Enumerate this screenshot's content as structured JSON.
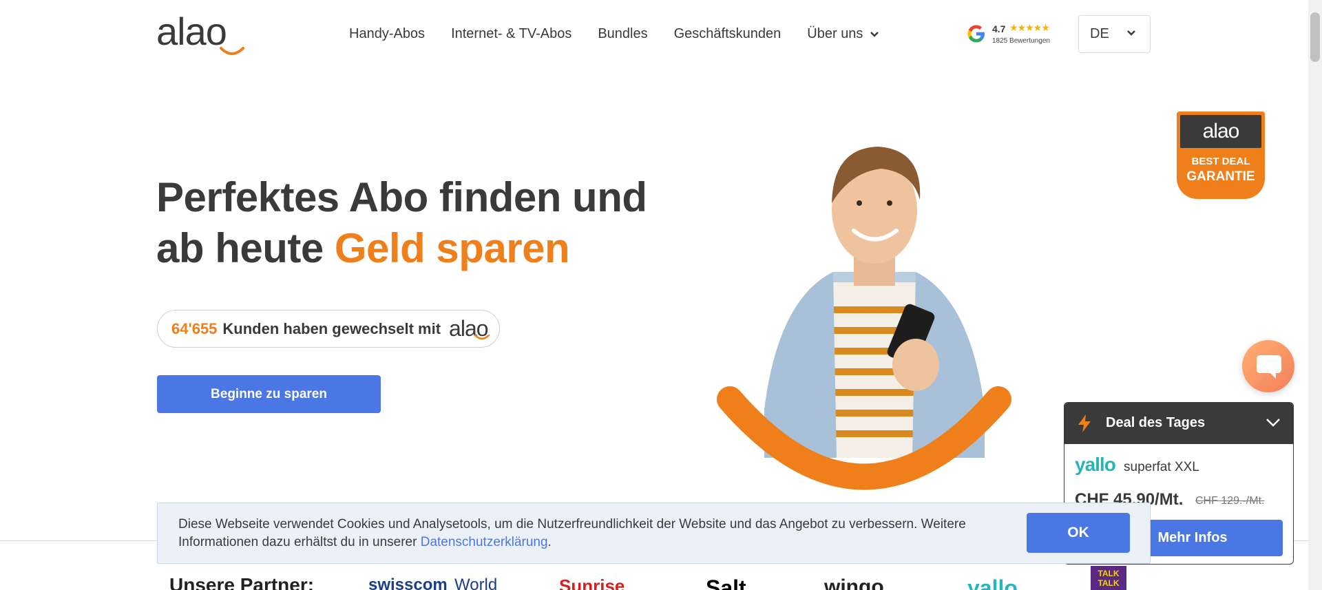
{
  "header": {
    "logo_text": "alao",
    "nav": [
      {
        "label": "Handy-Abos"
      },
      {
        "label": "Internet- & TV-Abos"
      },
      {
        "label": "Bundles"
      },
      {
        "label": "Geschäftskunden"
      },
      {
        "label": "Über uns"
      }
    ],
    "google": {
      "rating": "4.7",
      "stars": "★★★★★",
      "reviews": "1825 Bewertungen"
    },
    "language": "DE"
  },
  "hero": {
    "title_line1": "Perfektes Abo finden und",
    "title_line2_prefix": "ab heute ",
    "title_line2_accent": "Geld sparen",
    "counter_number": "64'655",
    "counter_text": "Kunden haben gewechselt mit",
    "counter_logo": "alao",
    "cta_label": "Beginne zu sparen"
  },
  "badge": {
    "logo": "alao",
    "line1": "BEST DEAL",
    "line2": "GARANTIE"
  },
  "deal": {
    "title": "Deal des Tages",
    "brand": "yallo",
    "plan": "superfat XXL",
    "price": "CHF 45.90/Mt.",
    "old_price": "CHF 129.-/Mt.",
    "more_label": "Mehr Infos"
  },
  "cookie": {
    "text": "Diese Webseite verwendet Cookies und Analysetools, um die Nutzerfreundlichkeit der Website und das Angebot zu verbessern. Weitere Informationen dazu erhältst du in unserer ",
    "link": "Datenschutzerklärung",
    "suffix": ".",
    "ok_label": "OK"
  },
  "partners": {
    "label": "Unsere Partner:",
    "items": [
      "swisscom",
      "World",
      "Sunrise",
      "Salt",
      "wingo",
      "yallo",
      "TALK TALK"
    ]
  },
  "colors": {
    "accent": "#ee7f1b",
    "primary": "#4a77e4",
    "dark": "#3a3a3a",
    "yallo": "#27b5b9"
  },
  "icons": {
    "google": "google-g-icon",
    "chevron": "chevron-down-icon",
    "bolt": "lightning-bolt-icon",
    "chat": "chat-bubble-icon"
  }
}
